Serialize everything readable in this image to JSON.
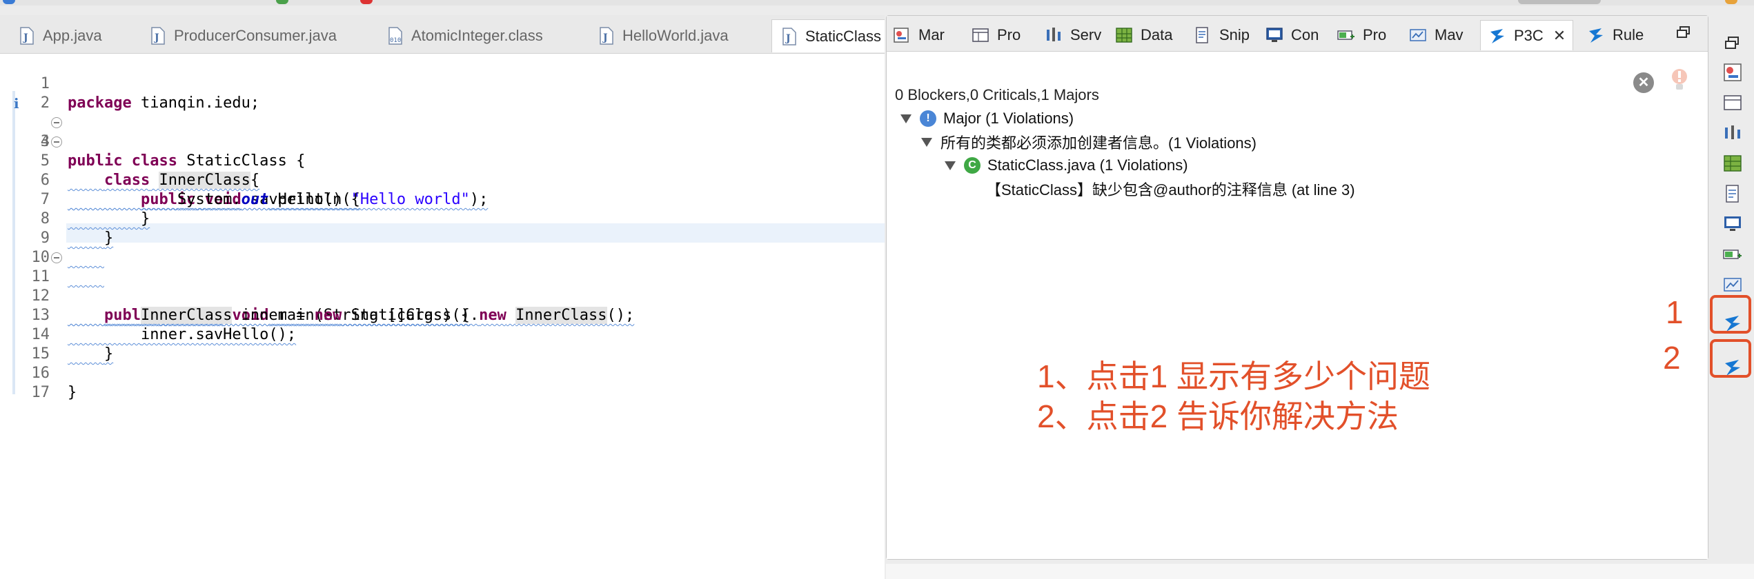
{
  "editor": {
    "tabs": [
      {
        "label": "App.java",
        "icon": "java-file-icon"
      },
      {
        "label": "ProducerConsumer.java",
        "icon": "java-file-icon"
      },
      {
        "label": "AtomicInteger.class",
        "icon": "class-file-icon"
      },
      {
        "label": "HelloWorld.java",
        "icon": "java-file-icon"
      },
      {
        "label": "StaticClass",
        "icon": "java-file-icon"
      }
    ],
    "lines": [
      {
        "n": "1"
      },
      {
        "n": "2"
      },
      {
        "n": "3"
      },
      {
        "n": "4"
      },
      {
        "n": "5"
      },
      {
        "n": "6"
      },
      {
        "n": "7"
      },
      {
        "n": "8"
      },
      {
        "n": "9"
      },
      {
        "n": "10"
      },
      {
        "n": "11"
      },
      {
        "n": "12"
      },
      {
        "n": "13"
      },
      {
        "n": "14"
      },
      {
        "n": "15"
      },
      {
        "n": "16"
      },
      {
        "n": "17"
      }
    ],
    "code": {
      "l1_kw": "package",
      "l1_rest": " tianqin.iedu;",
      "l3_kw1": "public",
      "l3_kw2": "class",
      "l3_rest": " StaticClass {",
      "l4_kw": "class",
      "l4_name": "InnerClass",
      "l4_rest": "{",
      "l5_kw1": "public",
      "l5_kw2": "void",
      "l5_rest": " savHello() {",
      "l6_a": "System.",
      "l6_fld": "out",
      "l6_b": ".println(",
      "l6_str": "\"Hello world\"",
      "l6_c": ");",
      "l7": "}",
      "l8": "}",
      "l11_kw1": "public",
      "l11_kw2": "static",
      "l11_kw3": "void",
      "l11_rest": " main(String []args) {",
      "l12_a": "InnerClass",
      "l12_b": " inner = ",
      "l12_kw1": "new",
      "l12_c": " StaticClass().",
      "l12_kw2": "new",
      "l12_d": " ",
      "l12_e": "InnerClass",
      "l12_f": "();",
      "l13": "inner.savHello();",
      "l14": "}",
      "l16": "}"
    }
  },
  "view": {
    "tabs": [
      {
        "label": "Mar",
        "icon": "markers-icon"
      },
      {
        "label": "Pro",
        "icon": "properties-icon"
      },
      {
        "label": "Serv",
        "icon": "servers-icon"
      },
      {
        "label": "Data",
        "icon": "data-source-icon"
      },
      {
        "label": "Snip",
        "icon": "snippets-icon"
      },
      {
        "label": "Con",
        "icon": "console-icon"
      },
      {
        "label": "Pro",
        "icon": "progress-icon"
      },
      {
        "label": "Mav",
        "icon": "maven-icon"
      },
      {
        "label": "P3C",
        "icon": "p3c-icon"
      },
      {
        "label": "Rule",
        "icon": "p3c-rule-icon"
      }
    ],
    "summary": "0 Blockers,0 Criticals,1 Majors",
    "tree": {
      "major": "Major (1 Violations)",
      "rule": "所有的类都必须添加创建者信息。(1 Violations)",
      "file": "StaticClass.java (1 Violations)",
      "detail": "【StaticClass】缺少包含@author的注释信息 (at line 3)"
    }
  },
  "annotations": {
    "line1": "1、点击1 显示有多少个问题",
    "line2": "2、点击2 告诉你解决方法",
    "mark1": "1",
    "mark2": "2"
  },
  "colors": {
    "annotation": "#e2502a",
    "keyword": "#7f0055",
    "string": "#2a00ff",
    "field": "#0000c0"
  }
}
